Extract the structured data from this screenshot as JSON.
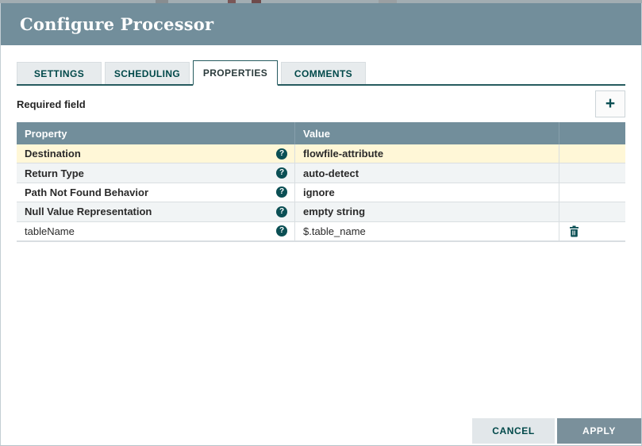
{
  "window": {
    "title": "Configure Processor"
  },
  "tabs": [
    {
      "label": "SETTINGS",
      "active": false
    },
    {
      "label": "SCHEDULING",
      "active": false
    },
    {
      "label": "PROPERTIES",
      "active": true
    },
    {
      "label": "COMMENTS",
      "active": false
    }
  ],
  "toolbar": {
    "required_label": "Required field",
    "add_icon": "+"
  },
  "icons": {
    "help_glyph": "?"
  },
  "table": {
    "columns": [
      "Property",
      "Value"
    ],
    "rows": [
      {
        "property": "Destination",
        "value": "flowfile-attribute",
        "required": true,
        "highlighted": true,
        "deletable": false
      },
      {
        "property": "Return Type",
        "value": "auto-detect",
        "required": true,
        "highlighted": false,
        "deletable": false
      },
      {
        "property": "Path Not Found Behavior",
        "value": "ignore",
        "required": true,
        "highlighted": false,
        "deletable": false
      },
      {
        "property": "Null Value Representation",
        "value": "empty string",
        "required": true,
        "highlighted": false,
        "deletable": false
      },
      {
        "property": "tableName",
        "value": "$.table_name",
        "required": false,
        "highlighted": false,
        "deletable": true
      }
    ]
  },
  "buttons": {
    "cancel": "CANCEL",
    "apply": "APPLY"
  },
  "colors": {
    "header_bg": "#728e9b",
    "teal_text": "#004849",
    "tab_border": "#265b5f",
    "highlight_row": "#fff7d7",
    "stripe_row": "#f1f4f5",
    "row_border": "#d9dee1",
    "icon_teal": "#0b4f54",
    "apply_bg": "#7a909b",
    "cancel_bg": "#e2e7ea"
  }
}
